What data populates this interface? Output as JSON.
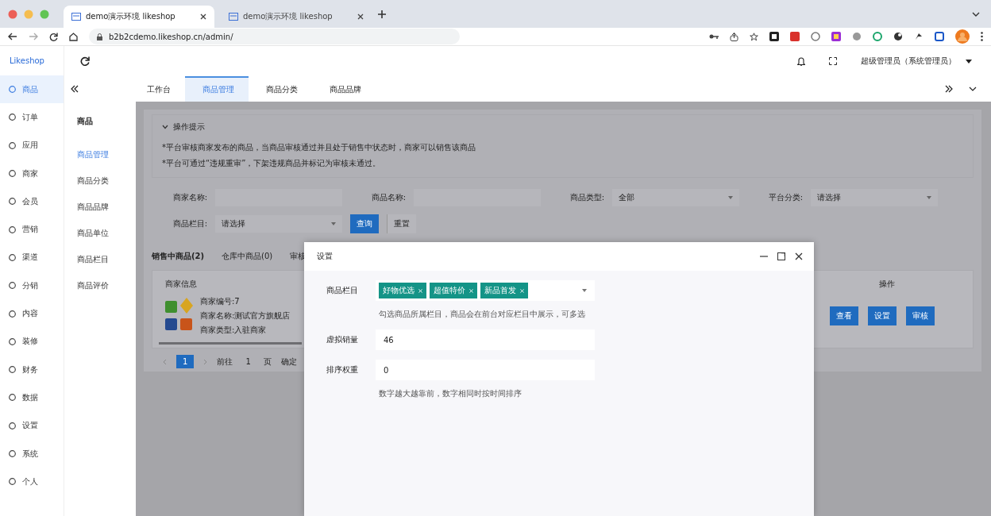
{
  "browser": {
    "tabs": [
      {
        "title": "demo演示环境 likeshop",
        "selected": true
      },
      {
        "title": "demo演示环境 likeshop",
        "selected": false
      }
    ],
    "url": "b2b2cdemo.likeshop.cn/admin/"
  },
  "app": {
    "logo": "Likeshop",
    "user": "超级管理员（系统管理员）"
  },
  "sidebar": {
    "items": [
      {
        "label": "商品",
        "selected": true
      },
      {
        "label": "订单",
        "selected": false
      },
      {
        "label": "应用",
        "selected": false
      },
      {
        "label": "商家",
        "selected": false
      },
      {
        "label": "会员",
        "selected": false
      },
      {
        "label": "营销",
        "selected": false
      },
      {
        "label": "渠道",
        "selected": false
      },
      {
        "label": "分销",
        "selected": false
      },
      {
        "label": "内容",
        "selected": false
      },
      {
        "label": "装修",
        "selected": false
      },
      {
        "label": "财务",
        "selected": false
      },
      {
        "label": "数据",
        "selected": false
      },
      {
        "label": "设置",
        "selected": false
      },
      {
        "label": "系统",
        "selected": false
      },
      {
        "label": "个人",
        "selected": false
      }
    ]
  },
  "submenu": {
    "title": "商品",
    "items": [
      {
        "label": "商品管理",
        "selected": true
      },
      {
        "label": "商品分类",
        "selected": false
      },
      {
        "label": "商品品牌",
        "selected": false
      },
      {
        "label": "商品单位",
        "selected": false
      },
      {
        "label": "商品栏目",
        "selected": false
      },
      {
        "label": "商品评价",
        "selected": false
      }
    ]
  },
  "page_tabs": [
    {
      "label": "工作台",
      "selected": false
    },
    {
      "label": "商品管理",
      "selected": true
    },
    {
      "label": "商品分类",
      "selected": false
    },
    {
      "label": "商品品牌",
      "selected": false
    }
  ],
  "tips": {
    "title": "操作提示",
    "expanded": true,
    "lines": [
      "*平台审核商家发布的商品，当商品审核通过并且处于销售中状态时，商家可以销售该商品",
      "*平台可通过“违规重审”，下架违规商品并标记为审核未通过。"
    ]
  },
  "filters": [
    {
      "kind": "text",
      "label": "商家名称:"
    },
    {
      "kind": "text",
      "label": "商品名称:"
    },
    {
      "kind": "select",
      "label": "商品类型:",
      "value": "全部"
    },
    {
      "kind": "select",
      "label": "平台分类:",
      "value": "请选择"
    },
    {
      "kind": "select",
      "label": "商品栏目:",
      "value": "请选择"
    }
  ],
  "filter_buttons": [
    {
      "kind": "primary",
      "label": "查询"
    },
    {
      "kind": "plain",
      "label": "重置"
    }
  ],
  "list_tabs": [
    {
      "label": "销售中商品(2)",
      "selected": true
    },
    {
      "label": "仓库中商品(0)",
      "selected": false
    },
    {
      "label": "审核",
      "selected": false
    }
  ],
  "table": {
    "columns": [
      {
        "label": "商家信息"
      },
      {
        "label": "操作"
      }
    ],
    "rows": [
      {
        "lines": [
          "商家编号:7",
          "商家名称:测试官方旗舰店",
          "商家类型:入驻商家"
        ],
        "actions": [
          "查看",
          "设置",
          "审核"
        ]
      }
    ]
  },
  "pagination": {
    "current": "1",
    "goto_label": "前往",
    "goto_value": "1",
    "unit": "页",
    "confirm": "确定"
  },
  "dialog": {
    "title": "设置",
    "fields": [
      {
        "kind": "tags",
        "label": "商品栏目",
        "tags": [
          "好物优选",
          "超值特价",
          "新品首发"
        ],
        "hint": "勾选商品所属栏目，商品会在前台对应栏目中展示，可多选"
      },
      {
        "kind": "input",
        "label": "虚拟销量",
        "value": "46"
      },
      {
        "kind": "input",
        "label": "排序权重",
        "value": "0",
        "hint": "数字越大越靠前，数字相同时按时间排序"
      }
    ]
  }
}
